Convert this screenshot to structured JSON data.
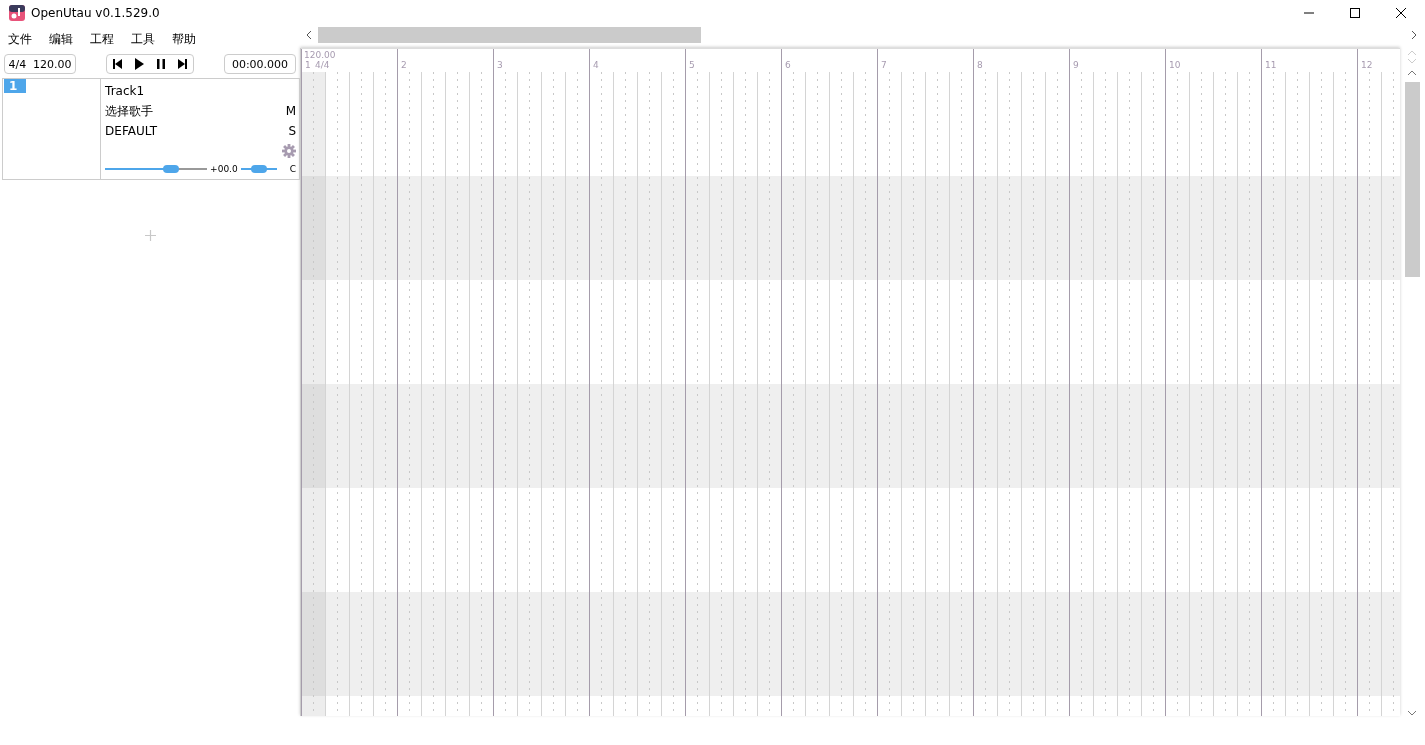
{
  "window": {
    "title": "OpenUtau v0.1.529.0"
  },
  "menu": [
    "文件",
    "编辑",
    "工程",
    "工具",
    "帮助"
  ],
  "toolbar": {
    "time_signature": "4/4",
    "tempo": "120.00",
    "time": "00:00.000"
  },
  "tracks": [
    {
      "number": "1",
      "name": "Track1",
      "singer": "选择歌手",
      "phonemizer": "DEFAULT",
      "mute": "M",
      "solo": "S",
      "volume": {
        "level": 0.65
      },
      "volume_reading": "+00.0",
      "pan": {
        "level": 0.5
      },
      "pan_reading": "C"
    }
  ],
  "ruler": {
    "tempo": "120.00",
    "time_signature": "4/4",
    "bars": [
      "1",
      "2",
      "3",
      "4",
      "5",
      "6",
      "7",
      "8",
      "9",
      "10",
      "11",
      "12"
    ]
  }
}
